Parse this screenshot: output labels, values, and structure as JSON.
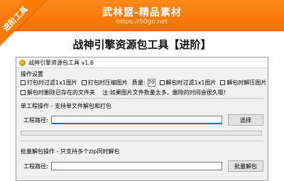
{
  "banner": {
    "title": "武林盟-精品素材",
    "url": "https://50go.net",
    "ribbon": "进阶工具"
  },
  "headline": "战神引擎资源包工具【进阶】",
  "window": {
    "title": "战神引擎资源包工具 v1.6"
  },
  "options": {
    "section_label": "操作设置",
    "opt1": "打包时过滤1x1图片",
    "opt2": "打包时压缩图片",
    "quality_label": "质量:",
    "quality_value": "70",
    "opt3": "解包时过滤1x1图片",
    "opt4": "解包时解压图片",
    "opt5": "解包时删除已存在的文件夹",
    "note": "注:如果图片文件数量太多，删除的时间会很久哦!"
  },
  "single": {
    "section_label": "单工程操作 - 支持单文件解包和打包",
    "path_label": "工程路径:",
    "path_value": "",
    "select_button": "选择",
    "progress": 0
  },
  "batch": {
    "section_label": "批量解包操作 - 只支持多个zip同时解包",
    "path_label": "工程路径:",
    "path_value": "",
    "batch_button": "批量解包"
  }
}
